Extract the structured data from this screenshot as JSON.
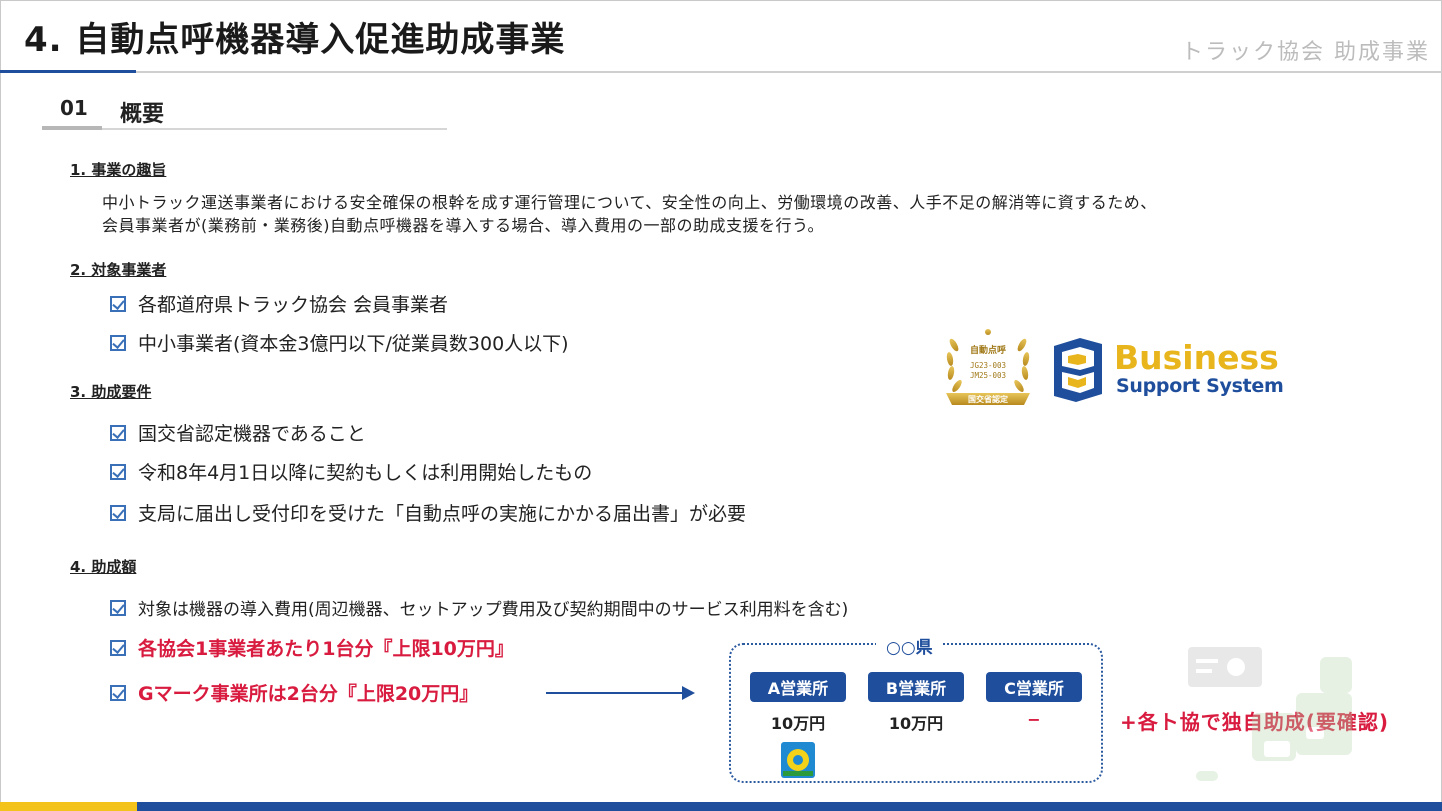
{
  "header": {
    "title": "4. 自動点呼機器導入促進助成事業",
    "subtitle": "トラック協会 助成事業"
  },
  "section": {
    "number": "01",
    "title": "概要"
  },
  "purpose": {
    "heading": "1. 事業の趣旨",
    "line1": "中小トラック運送事業者における安全確保の根幹を成す運行管理について、安全性の向上、労働環境の改善、人手不足の解消等に資するため、",
    "line2": "会員事業者が(業務前・業務後)自動点呼機器を導入する場合、導入費用の一部の助成支援を行う。"
  },
  "targets": {
    "heading": "2. 対象事業者",
    "items": [
      "各都道府県トラック協会 会員事業者",
      "中小事業者(資本金3億円以下/従業員数300人以下)"
    ]
  },
  "requirements": {
    "heading": "3. 助成要件",
    "items": [
      "国交省認定機器であること",
      "令和8年4月1日以降に契約もしくは利用開始したもの",
      "支局に届出し受付印を受けた「自動点呼の実施にかかる届出書」が必要"
    ]
  },
  "amount": {
    "heading": "4. 助成額",
    "items": [
      "対象は機器の導入費用(周辺機器、セットアップ費用及び契約期間中のサービス利用料を含む)",
      "各協会1事業者あたり1台分『上限10万円』",
      "Gマーク事業所は2台分『上限20万円』"
    ]
  },
  "example": {
    "prefecture": "○○県",
    "offices": [
      {
        "name": "A営業所",
        "amount": "10万円"
      },
      {
        "name": "B営業所",
        "amount": "10万円"
      },
      {
        "name": "C営業所",
        "amount": "−"
      }
    ],
    "extra": "+各ト協で独自助成(要確認)"
  },
  "badge": {
    "line1": "自動点呼",
    "line2": "JG23-003",
    "line3": "JM25-003",
    "ribbon": "国交省認定"
  },
  "logo": {
    "line1": "Business",
    "line2": "Support System"
  },
  "colors": {
    "accent_blue": "#1f4e9c",
    "accent_red": "#d81b3f",
    "gold": "#f3c21b",
    "logo_gold": "#e8b51c"
  },
  "icons": [
    "checkbox-icon",
    "arrow-right-icon",
    "g-mark-icon",
    "laurel-badge-icon",
    "bss-logo-icon"
  ]
}
